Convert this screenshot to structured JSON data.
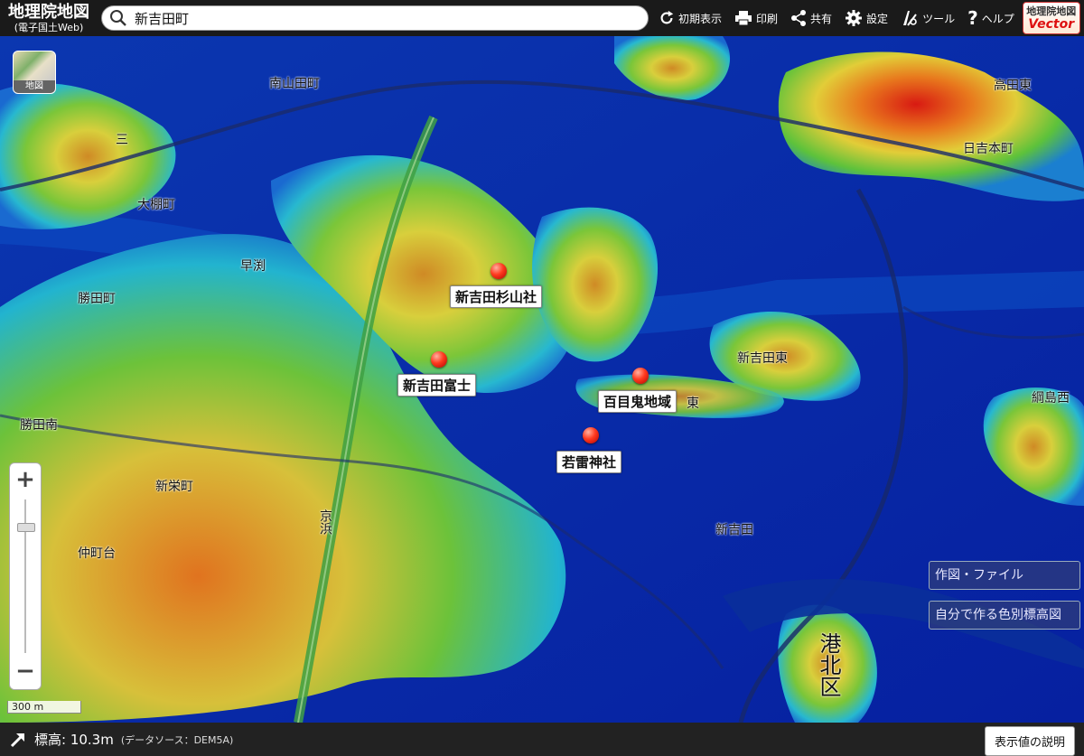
{
  "header": {
    "brand_title": "地理院地図",
    "brand_sub": "(電子国土Web)",
    "search_value": "新吉田町",
    "tools": [
      {
        "icon": "reset-icon",
        "label": "初期表示"
      },
      {
        "icon": "print-icon",
        "label": "印刷"
      },
      {
        "icon": "share-icon",
        "label": "共有"
      },
      {
        "icon": "gear-icon",
        "label": "設定"
      },
      {
        "icon": "tools-icon",
        "label": "ツール"
      },
      {
        "icon": "help-icon",
        "label": "ヘルプ"
      }
    ],
    "vector_badge_top": "地理院地図",
    "vector_badge_bottom": "Vector"
  },
  "map": {
    "layer_button_label": "地図",
    "markers": [
      {
        "label": "新吉田杉山社"
      },
      {
        "label": "新吉田富士"
      },
      {
        "label": "百目鬼地域"
      },
      {
        "label": "若雷神社"
      }
    ],
    "place_labels": [
      "南山田町",
      "早渕",
      "勝田町",
      "大棚町",
      "勝田南",
      "新栄町",
      "仲町台",
      "新吉田東",
      "綱島西",
      "高田東",
      "日吉本町",
      "三",
      "東",
      "新吉田"
    ],
    "vertical_labels": [
      "京浜",
      "港北区"
    ],
    "scale_text": "300 m",
    "zoom_in": "+",
    "zoom_out": "−",
    "side_buttons": [
      "作図・ファイル",
      "自分で作る色別標高図"
    ]
  },
  "footer": {
    "elevation_label": "標高: 10.3m",
    "source": "(データソース：DEM5A)",
    "explain_button": "表示値の説明"
  },
  "colors": {
    "low": "#0a2a9a",
    "mid": "#2bb3d8",
    "green": "#5cc23a",
    "yellow": "#e3d23a",
    "high": "#e06a1e",
    "peak": "#d61b14"
  }
}
